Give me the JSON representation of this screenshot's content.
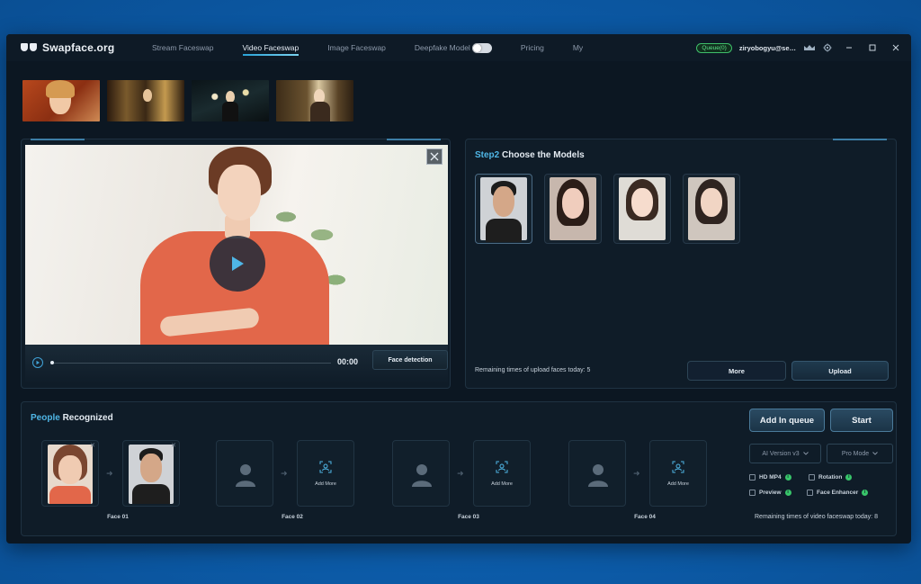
{
  "app": {
    "title": "Swapface.org",
    "nav": [
      "Stream Faceswap",
      "Video Faceswap",
      "Image Faceswap",
      "Deepfake Model",
      "Pricing",
      "My"
    ],
    "active_tab": "Video Faceswap",
    "queue_badge": "Queue(0)",
    "user_email": "ziryobogyu@se…"
  },
  "video": {
    "time": "00:00",
    "face_detection_label": "Face detection"
  },
  "models_panel": {
    "title_highlight": "Step2",
    "title_rest": " Choose the Models",
    "remaining_text": "Remaining times of upload faces today: 5",
    "more_label": "More",
    "upload_label": "Upload"
  },
  "people_panel": {
    "title_highlight": "People",
    "title_rest": " Recognized",
    "faces": [
      {
        "label": "Face 01",
        "add_more": ""
      },
      {
        "label": "Face 02",
        "add_more": "Add More"
      },
      {
        "label": "Face 03",
        "add_more": "Add More"
      },
      {
        "label": "Face 04",
        "add_more": "Add More"
      }
    ],
    "add_queue_label": "Add In queue",
    "start_label": "Start",
    "ai_version": "AI Version v3",
    "pro_mode": "Pro Mode",
    "options": {
      "hd_mp4": "HD MP4",
      "rotation": "Rotation",
      "preview": "Preview",
      "face_enhancer": "Face Enhancer"
    },
    "remaining_text": "Remaining times of video faceswap today: 8"
  },
  "colors": {
    "accent": "#4fb6e6",
    "queue_green": "#5ee08a",
    "background_blue": "#0b5fb0",
    "panel": "#0f1c28"
  }
}
